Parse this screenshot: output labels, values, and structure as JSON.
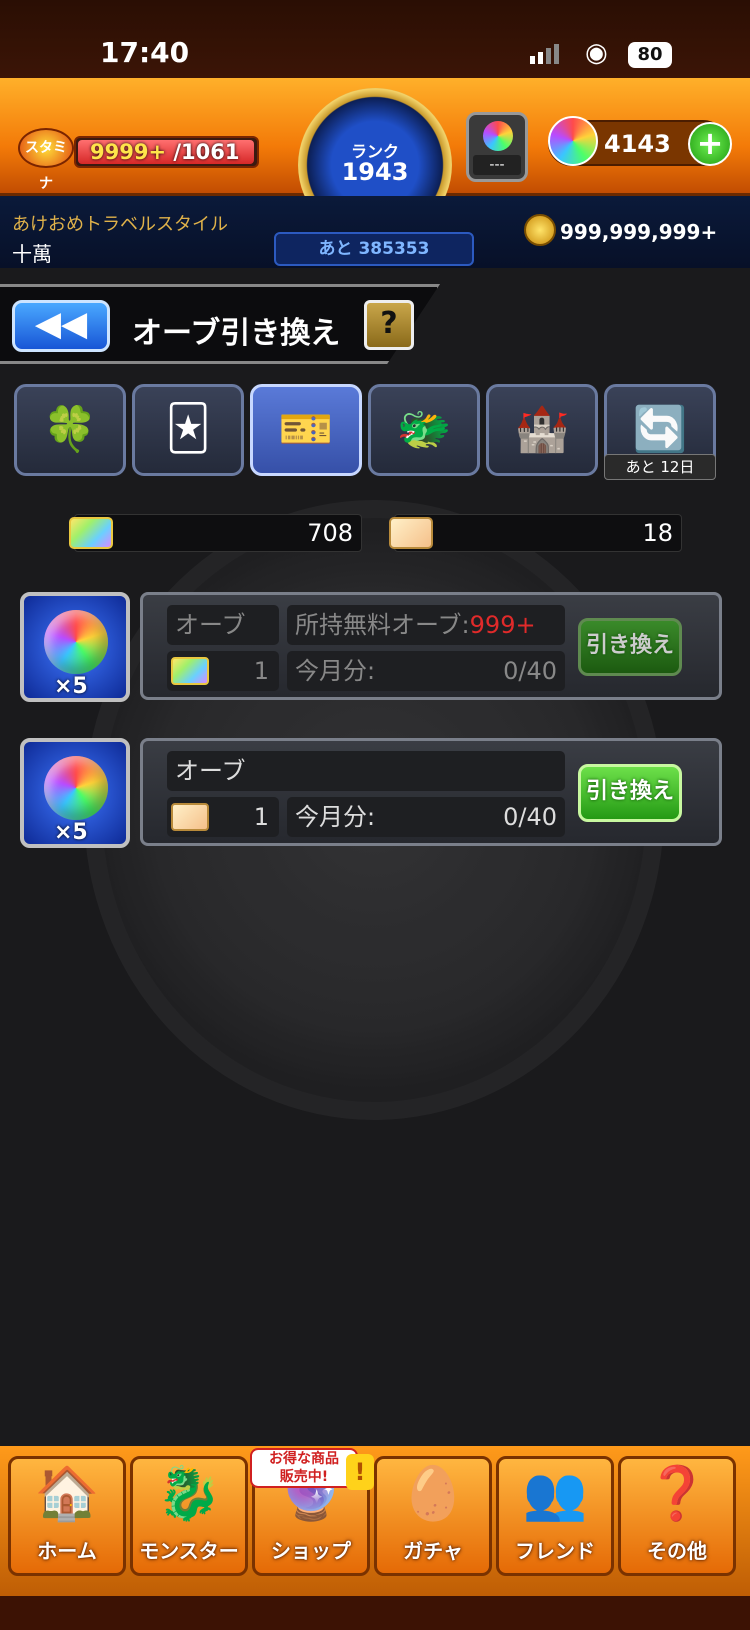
{
  "status_bar": {
    "time": "17:40",
    "battery": "80"
  },
  "header": {
    "stamina_label": "スタミナ",
    "stamina_current": "9999+",
    "stamina_max": "/1061",
    "rank_label": "ランク",
    "rank_value": "1943",
    "orb_slot_value": "---",
    "orb_count": "4143",
    "player_title": "あけおめトラベルスタイル",
    "player_name": "十萬",
    "rank_remaining": "あと 385353",
    "gold": "999,999,999+"
  },
  "title_bar": {
    "title": "オーブ引き換え",
    "help": "?"
  },
  "tabs": [
    {
      "icon": "clover-hat-icon",
      "active": false
    },
    {
      "icon": "card-pack-icon",
      "active": false
    },
    {
      "icon": "orb-ticket-icon",
      "active": true
    },
    {
      "icon": "monster-character-icon",
      "active": false
    },
    {
      "icon": "map-stage-icon",
      "active": false
    },
    {
      "icon": "orb-transfer-icon",
      "active": false,
      "timer": "あと 12日"
    }
  ],
  "counters": [
    {
      "icon": "rainbow-ticket-icon",
      "value": "708"
    },
    {
      "icon": "gold-ticket-icon",
      "value": "18"
    }
  ],
  "exchange_rows": [
    {
      "item_qty": "×5",
      "item_label": "オーブ",
      "free_orb_label": "所持無料オーブ:",
      "free_orb_value": "999+",
      "cost": "1",
      "monthly_label": "今月分:",
      "monthly_value": "0/40",
      "button_label": "引き換え",
      "ticket": "rainbow-ticket-icon"
    },
    {
      "item_qty": "×5",
      "item_label": "オーブ",
      "cost": "1",
      "monthly_label": "今月分:",
      "monthly_value": "0/40",
      "button_label": "引き換え",
      "ticket": "gold-ticket-icon"
    }
  ],
  "nav": {
    "home": "ホーム",
    "monster": "モンスター",
    "shop": "ショップ",
    "gacha": "ガチャ",
    "friend": "フレンド",
    "other": "その他",
    "shop_badge_line1": "お得な商品",
    "shop_badge_line2": "販売中!",
    "alert": "!"
  },
  "colors": {
    "accent": "#f37a08",
    "button_green": "#249a14",
    "warning_red": "#e02a2a"
  }
}
